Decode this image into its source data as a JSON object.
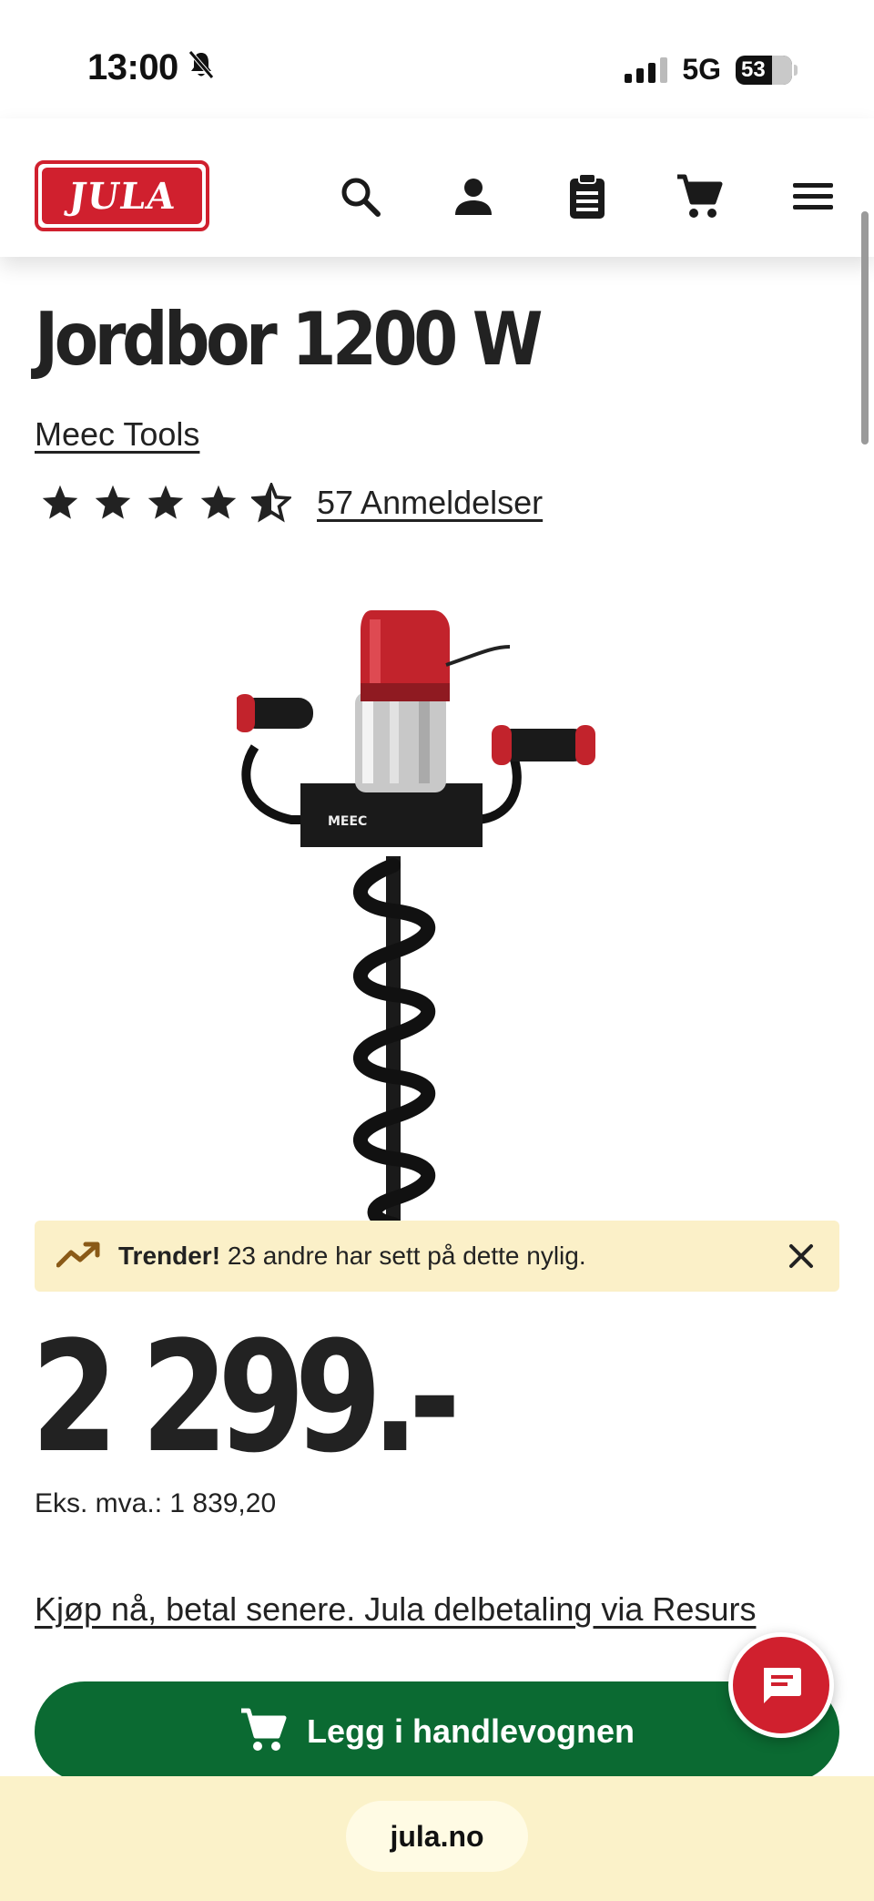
{
  "status_bar": {
    "time": "13:00",
    "network": "5G",
    "battery": "53"
  },
  "header": {
    "logo_text": "JULA",
    "icons": [
      "search-icon",
      "account-icon",
      "shopping-list-icon",
      "cart-icon",
      "menu-icon"
    ]
  },
  "product": {
    "title": "Jordbor 1200 W",
    "brand": "Meec Tools",
    "rating": 4.5,
    "reviews_label": "57 Anmeldelser"
  },
  "trend_banner": {
    "title": "Trender!",
    "text": "23 andre har sett på dette nylig."
  },
  "price": {
    "value": "2 299.-",
    "ex_vat": "Eks. mva.: 1 839,20"
  },
  "financing_link": "Kjøp nå, betal senere. Jula delbetaling via Resurs",
  "add_to_cart_label": "Legg i handlevognen",
  "browser": {
    "url": "jula.no"
  },
  "colors": {
    "brand_red": "#d0202e",
    "cart_green": "#0b6a32",
    "banner_yellow": "#fbf0c8"
  }
}
